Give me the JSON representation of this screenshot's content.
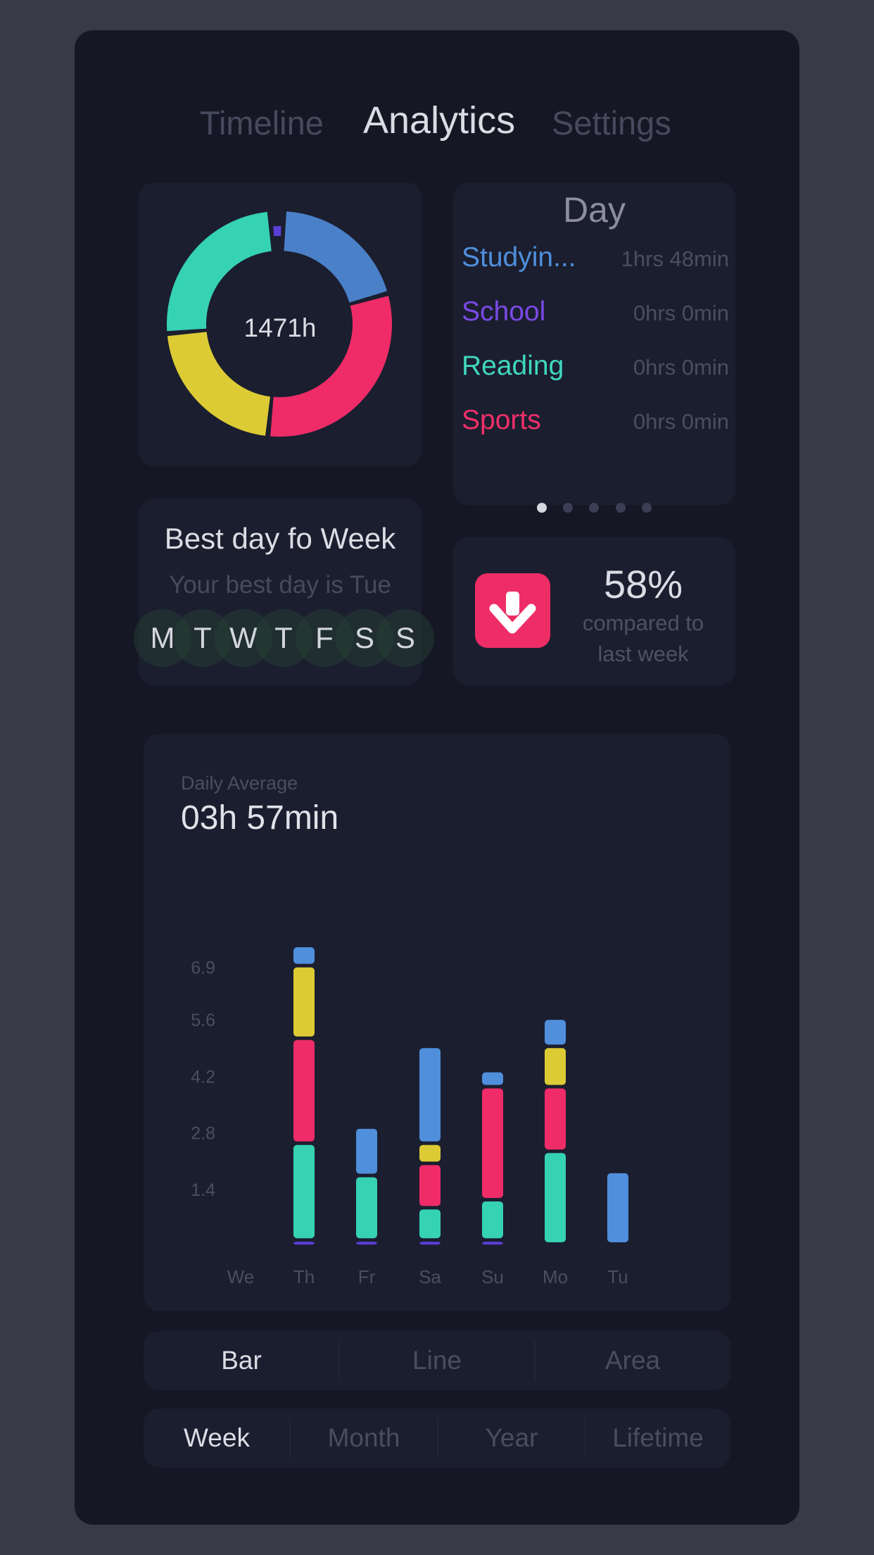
{
  "tabs": [
    {
      "label": "Timeline",
      "active": false
    },
    {
      "label": "Analytics",
      "active": true
    },
    {
      "label": "Settings",
      "active": false
    }
  ],
  "donut": {
    "total_label": "1471h",
    "segments": [
      {
        "name": "blue-segment",
        "color": "#4a80c8",
        "fraction": 0.2
      },
      {
        "name": "pink-segment",
        "color": "#ef2c68",
        "fraction": 0.31
      },
      {
        "name": "yellow-segment",
        "color": "#dccb35",
        "fraction": 0.22
      },
      {
        "name": "teal-segment",
        "color": "#36d2b4",
        "fraction": 0.25
      },
      {
        "name": "purple-segment",
        "color": "#5b3ed6",
        "fraction": 0.02
      }
    ]
  },
  "day_list": {
    "title": "Day",
    "rows": [
      {
        "name": "Studyin...",
        "time": "1hrs 48min",
        "color": "#4f8fdc"
      },
      {
        "name": "School",
        "time": "0hrs 0min",
        "color": "#7a4ae6"
      },
      {
        "name": "Reading",
        "time": "0hrs 0min",
        "color": "#3fd8bd"
      },
      {
        "name": "Sports",
        "time": "0hrs 0min",
        "color": "#ef2f6a"
      }
    ],
    "page_count": 5,
    "active_page": 0
  },
  "best_day": {
    "title": "Best day fo Week",
    "subtitle": "Your best day is Tue",
    "days": [
      "M",
      "T",
      "W",
      "T",
      "F",
      "S",
      "S"
    ]
  },
  "comparison": {
    "percent": "58%",
    "caption_line1": "compared to",
    "caption_line2": "last week",
    "direction_icon": "arrow-down-icon",
    "color": "#ee2d66"
  },
  "daily_average": {
    "label": "Daily Average",
    "value": "03h 57min"
  },
  "chart_data": {
    "type": "bar",
    "stacked": true,
    "categories": [
      "We",
      "Th",
      "Fr",
      "Sa",
      "Su",
      "Mo",
      "Tu"
    ],
    "y_ticks": [
      "6.9",
      "5.6",
      "4.2",
      "2.8",
      "1.4"
    ],
    "ylim": [
      0,
      7.4
    ],
    "series": [
      {
        "color": "#5b3ed6",
        "values": [
          0,
          0.1,
          0.1,
          0.1,
          0.1,
          0,
          0
        ]
      },
      {
        "color": "#36d2b4",
        "values": [
          0,
          2.4,
          1.6,
          0.8,
          1.0,
          2.3,
          0
        ]
      },
      {
        "color": "#ef2c68",
        "values": [
          0,
          2.6,
          0,
          1.1,
          2.8,
          1.6,
          0
        ]
      },
      {
        "color": "#dccb35",
        "values": [
          0,
          1.8,
          0,
          0.5,
          0,
          1.0,
          0
        ]
      },
      {
        "color": "#4f8fdc",
        "values": [
          0,
          0.5,
          1.2,
          2.4,
          0.4,
          0.7,
          1.8
        ]
      }
    ]
  },
  "chart_style": {
    "chart_type": "Bar",
    "time_range": "Week"
  },
  "chart_types": [
    "Bar",
    "Line",
    "Area"
  ],
  "ranges": [
    "Week",
    "Month",
    "Year",
    "Lifetime"
  ]
}
